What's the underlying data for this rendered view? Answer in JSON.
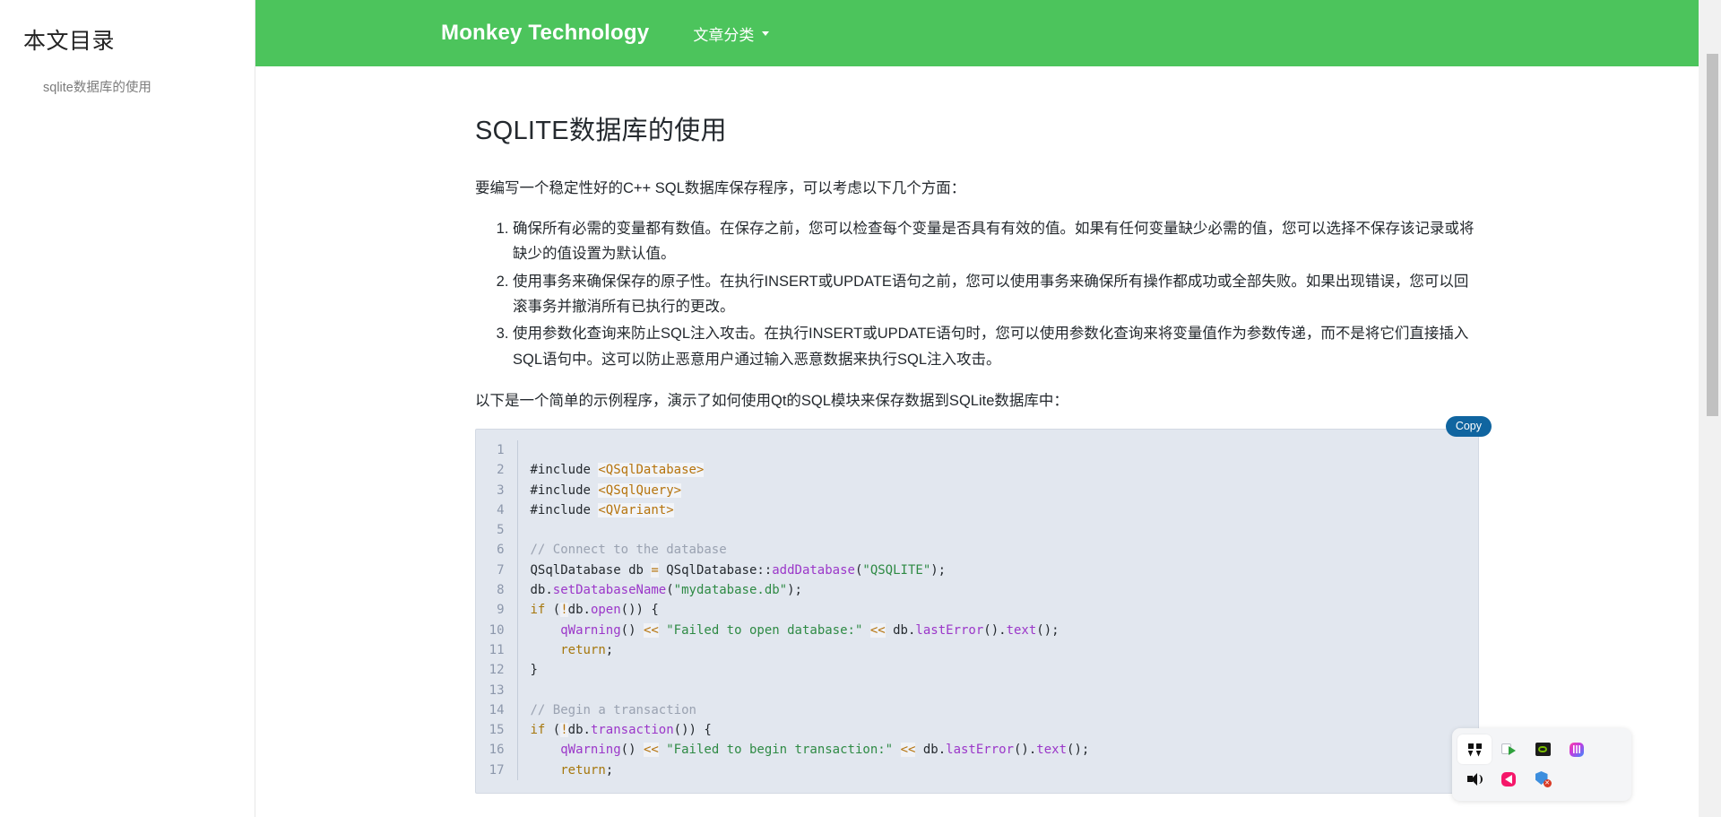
{
  "sidebar": {
    "title": "本文目录",
    "items": [
      {
        "label": "sqlite数据库的使用"
      }
    ]
  },
  "navbar": {
    "brand": "Monkey Technology",
    "menu": [
      {
        "label": "文章分类",
        "icon": "chevron-down-icon"
      }
    ]
  },
  "article": {
    "title": "SQLITE数据库的使用",
    "intro": "要编写一个稳定性好的C++ SQL数据库保存程序，可以考虑以下几个方面：",
    "points": [
      "确保所有必需的变量都有数值。在保存之前，您可以检查每个变量是否具有有效的值。如果有任何变量缺少必需的值，您可以选择不保存该记录或将缺少的值设置为默认值。",
      "使用事务来确保保存的原子性。在执行INSERT或UPDATE语句之前，您可以使用事务来确保所有操作都成功或全部失败。如果出现错误，您可以回滚事务并撤消所有已执行的更改。",
      "使用参数化查询来防止SQL注入攻击。在执行INSERT或UPDATE语句时，您可以使用参数化查询来将变量值作为参数传递，而不是将它们直接插入SQL语句中。这可以防止恶意用户通过输入恶意数据来执行SQL注入攻击。"
    ],
    "outro": "以下是一个简单的示例程序，演示了如何使用Qt的SQL模块来保存数据到SQLite数据库中："
  },
  "code": {
    "copy_label": "Copy",
    "language": "cpp",
    "line_numbers": [
      "1",
      "2",
      "3",
      "4",
      "5",
      "6",
      "7",
      "8",
      "9",
      "10",
      "11",
      "12",
      "13",
      "14",
      "15",
      "16",
      "17"
    ],
    "lines": [
      "",
      "#include <QSqlDatabase>",
      "#include <QSqlQuery>",
      "#include <QVariant>",
      "",
      "// Connect to the database",
      "QSqlDatabase db = QSqlDatabase::addDatabase(\"QSQLITE\");",
      "db.setDatabaseName(\"mydatabase.db\");",
      "if (!db.open()) {",
      "    qWarning() << \"Failed to open database:\" << db.lastError().text();",
      "    return;",
      "}",
      "",
      "// Begin a transaction",
      "if (!db.transaction()) {",
      "    qWarning() << \"Failed to begin transaction:\" << db.lastError().text();",
      "    return;"
    ]
  },
  "tray": {
    "icons": [
      {
        "name": "apps-grid-icon",
        "selected": true
      },
      {
        "name": "screen-play-icon",
        "selected": false
      },
      {
        "name": "nvidia-icon",
        "selected": false
      },
      {
        "name": "gradient-app-icon",
        "selected": false
      },
      {
        "name": "speaker-icon",
        "selected": false
      },
      {
        "name": "pink-app-icon",
        "selected": false
      },
      {
        "name": "security-shield-icon",
        "selected": false
      }
    ]
  },
  "colors": {
    "brand_green": "#4cc45c",
    "copy_button": "#1065a0",
    "code_background": "#e2e7ef",
    "text": "#24292e"
  }
}
